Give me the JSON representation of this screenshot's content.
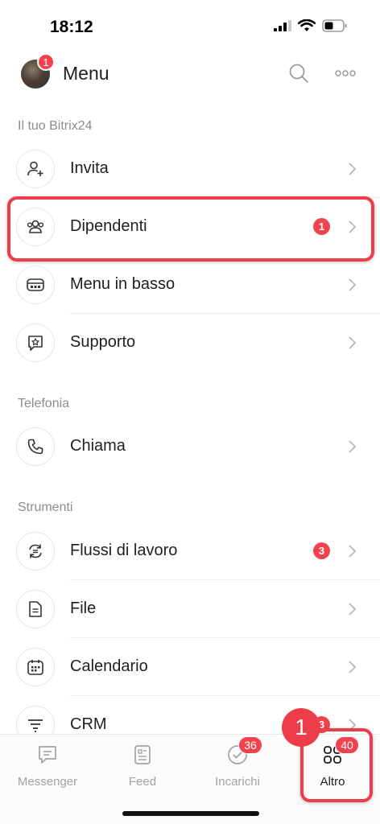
{
  "status_bar": {
    "time": "18:12"
  },
  "header": {
    "title": "Menu",
    "avatar_badge": "1"
  },
  "sections": [
    {
      "label": "Il tuo Bitrix24",
      "items": [
        {
          "label": "Invita",
          "icon": "invite-user-icon",
          "badge": null
        },
        {
          "label": "Dipendenti",
          "icon": "employees-icon",
          "badge": "1",
          "highlighted": true
        },
        {
          "label": "Menu in basso",
          "icon": "bottom-menu-icon",
          "badge": null
        },
        {
          "label": "Supporto",
          "icon": "support-icon",
          "badge": null
        }
      ]
    },
    {
      "label": "Telefonia",
      "items": [
        {
          "label": "Chiama",
          "icon": "phone-icon",
          "badge": null
        }
      ]
    },
    {
      "label": "Strumenti",
      "items": [
        {
          "label": "Flussi di lavoro",
          "icon": "workflow-icon",
          "badge": "3"
        },
        {
          "label": "File",
          "icon": "file-icon",
          "badge": null
        },
        {
          "label": "Calendario",
          "icon": "calendar-icon",
          "badge": null
        },
        {
          "label": "CRM",
          "icon": "crm-icon",
          "badge": "3"
        }
      ]
    }
  ],
  "tabbar": {
    "tabs": [
      {
        "label": "Messenger",
        "icon": "messenger-icon",
        "badge": null
      },
      {
        "label": "Feed",
        "icon": "feed-icon",
        "badge": null
      },
      {
        "label": "Incarichi",
        "icon": "tasks-icon",
        "badge": "36"
      },
      {
        "label": "Altro",
        "icon": "more-grid-icon",
        "badge": "40",
        "active": true
      }
    ]
  },
  "step_marker": "1",
  "colors": {
    "accent_red": "#ee3d4a",
    "badge_red": "#f0434f",
    "label_gray": "#8c8c8c"
  }
}
